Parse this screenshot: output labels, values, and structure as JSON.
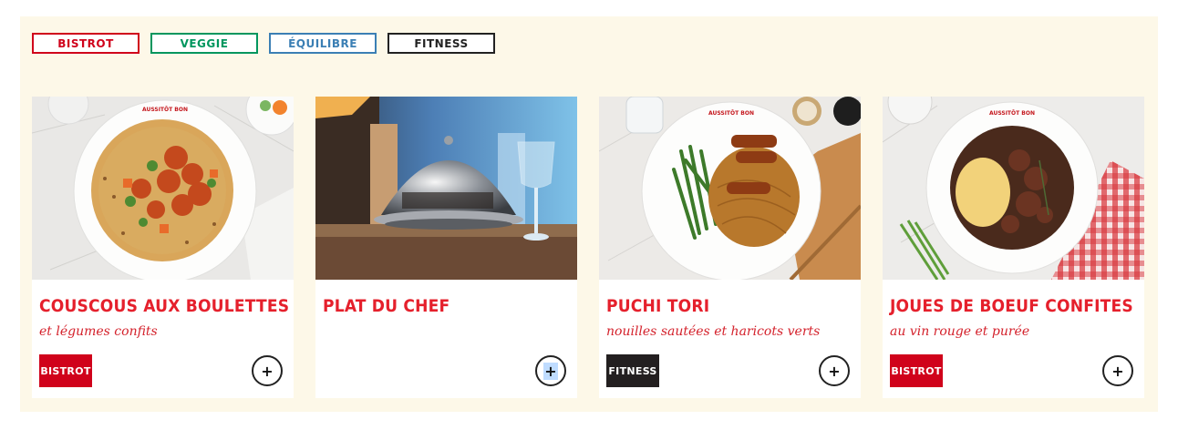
{
  "filters": [
    {
      "label": "BISTROT",
      "color": "#d0021b"
    },
    {
      "label": "VEGGIE",
      "color": "#00965e"
    },
    {
      "label": "ÉQUILIBRE",
      "color": "#3b7fb4"
    },
    {
      "label": "FITNESS",
      "color": "#222222"
    }
  ],
  "brand_logo": "AUSSITÔT BON",
  "cards": [
    {
      "title": "COUSCOUS AUX BOULETTES",
      "subtitle": "et légumes confits",
      "tag": "BISTROT",
      "tag_color": "#d0021b",
      "add_icon": "+"
    },
    {
      "title": "PLAT DU CHEF",
      "subtitle": "",
      "tag": "",
      "tag_color": "",
      "add_icon": "+"
    },
    {
      "title": "PUCHI TORI",
      "subtitle": "nouilles sautées et haricots verts",
      "tag": "FITNESS",
      "tag_color": "#231f20",
      "add_icon": "+"
    },
    {
      "title": "JOUES DE BOEUF CONFITES",
      "subtitle": "au vin rouge et purée",
      "tag": "BISTROT",
      "tag_color": "#d0021b",
      "add_icon": "+"
    }
  ],
  "colors": {
    "panel_bg": "#fdf8e8",
    "title_red": "#e5202c"
  }
}
